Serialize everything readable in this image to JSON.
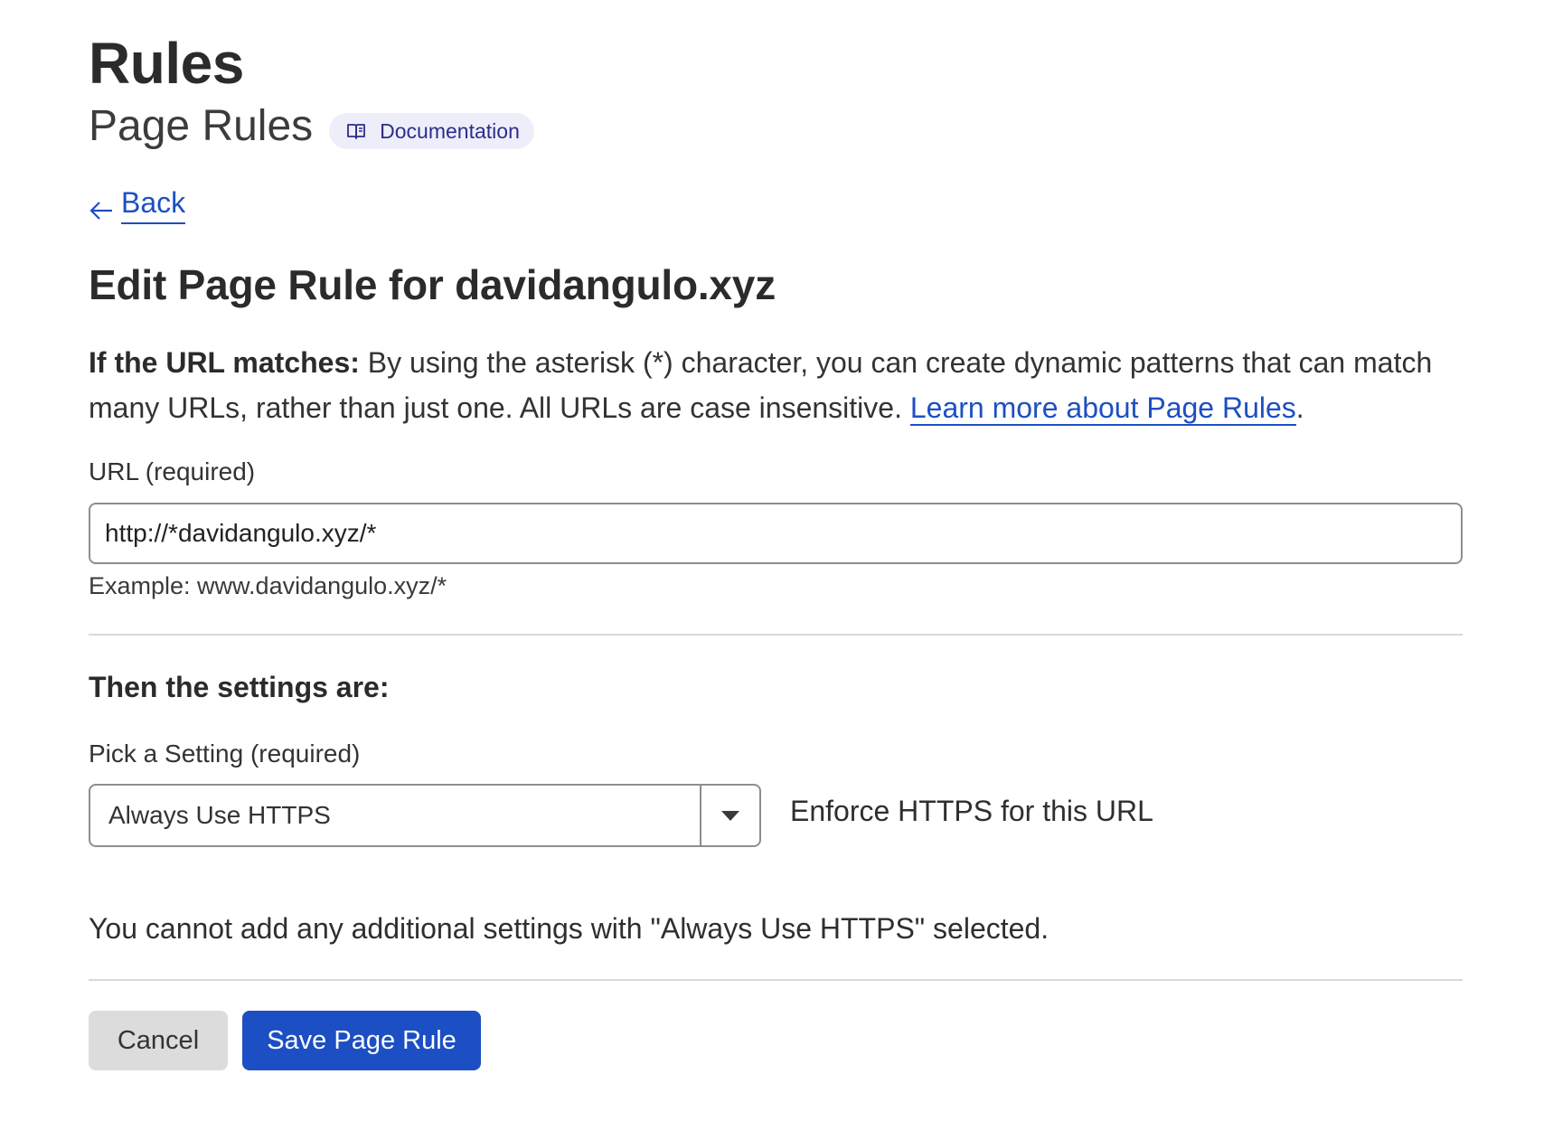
{
  "header": {
    "title": "Rules",
    "subtitle": "Page Rules",
    "doc_link_label": "Documentation",
    "doc_icon": "book-icon"
  },
  "nav": {
    "back_label": "Back",
    "back_icon": "arrow-left-icon"
  },
  "form": {
    "heading": "Edit Page Rule for davidangulo.xyz",
    "intro_bold": "If the URL matches:",
    "intro_text": " By using the asterisk (*) character, you can create dynamic patterns that can match many URLs, rather than just one. All URLs are case insensitive. ",
    "intro_link": "Learn more about Page Rules",
    "intro_end": ".",
    "url_label": "URL (required)",
    "url_value": "http://*davidangulo.xyz/*",
    "url_example": "Example: www.davidangulo.xyz/*",
    "settings_heading": "Then the settings are:",
    "setting_label": "Pick a Setting (required)",
    "setting_selected": "Always Use HTTPS",
    "setting_description": "Enforce HTTPS for this URL",
    "notice": "You cannot add any additional settings with \"Always Use HTTPS\" selected."
  },
  "actions": {
    "cancel_label": "Cancel",
    "save_label": "Save Page Rule"
  },
  "colors": {
    "link": "#1d4fc2",
    "primary_button": "#1c4fc3",
    "secondary_button": "#dcdcdc",
    "doc_pill_bg": "#eeeefb"
  }
}
